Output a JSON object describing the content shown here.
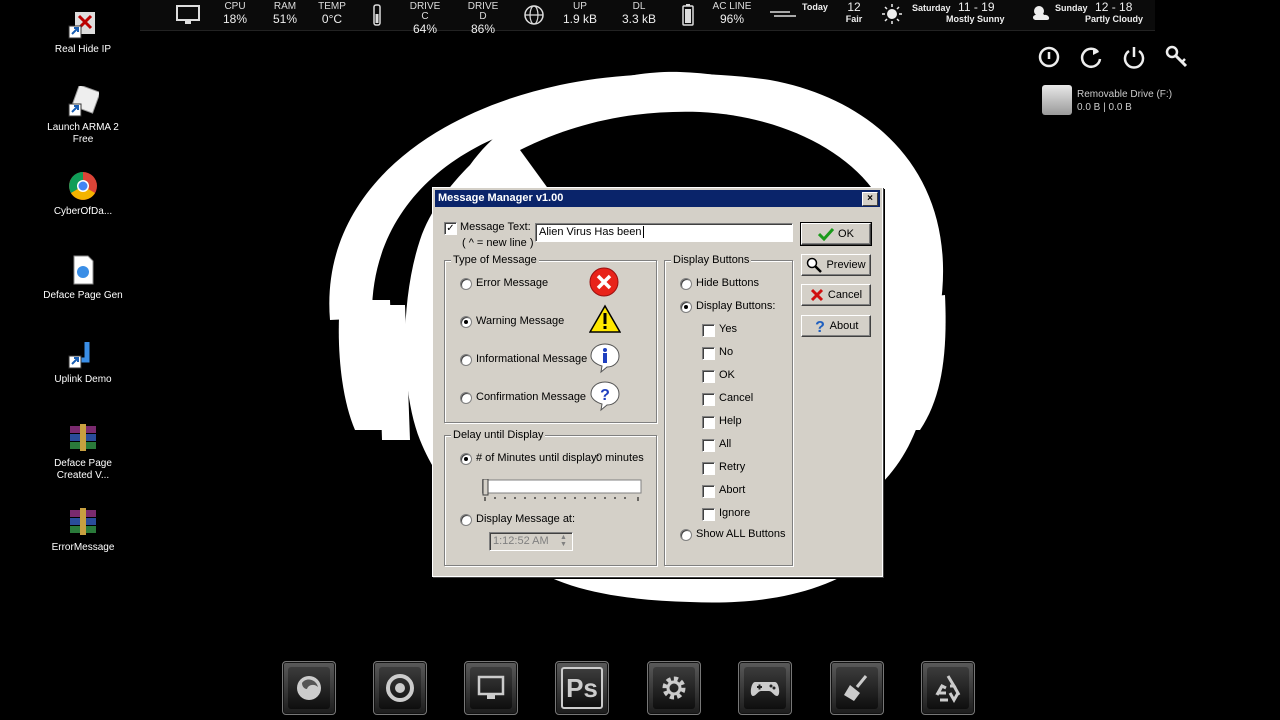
{
  "desktop": {
    "icons": [
      {
        "label": "Real Hide IP"
      },
      {
        "label": "Launch ARMA 2 Free"
      },
      {
        "label": "CyberOfDa..."
      },
      {
        "label": "Deface Page Gen"
      },
      {
        "label": "Uplink Demo"
      },
      {
        "label": "Deface Page Created V..."
      },
      {
        "label": "ErrorMessage"
      }
    ]
  },
  "statusbar": {
    "cpu": {
      "label": "CPU",
      "value": "18%"
    },
    "ram": {
      "label": "RAM",
      "value": "51%"
    },
    "temp": {
      "label": "TEMP",
      "value": "0°C"
    },
    "drive_c": {
      "label": "DRIVE C",
      "value": "64%"
    },
    "drive_d": {
      "label": "DRIVE D",
      "value": "86%"
    },
    "up": {
      "label": "UP",
      "value": "1.9 kB"
    },
    "dl": {
      "label": "DL",
      "value": "3.3 kB"
    },
    "ac": {
      "label": "AC LINE",
      "value": "96%"
    },
    "today": {
      "day": "Today",
      "temp": "12",
      "cond": "Fair"
    },
    "saturday": {
      "day": "Saturday",
      "range": "11 - 19",
      "cond": "Mostly Sunny"
    },
    "sunday": {
      "day": "Sunday",
      "range": "12 - 18",
      "cond": "Partly Cloudy"
    }
  },
  "drive_gadget": {
    "name": "Removable Drive (F:)",
    "usage": "0.0 B |   0.0 B"
  },
  "dialog": {
    "title": "Message Manager v1.00",
    "close": "×",
    "message_text_label": "Message Text:",
    "new_line_hint": "( ^ = new line )",
    "message_text_value": "Alien Virus Has been",
    "type_group": "Type of Message",
    "types": [
      "Error Message",
      "Warning Message",
      "Informational Message",
      "Confirmation Message"
    ],
    "selected_type": 1,
    "delay_group": "Delay until Display",
    "minutes_label": "# of Minutes until display:",
    "minutes_value": "0 minutes",
    "display_at_label": "Display Message at:",
    "time_value": "1:12:52 AM",
    "buttons_group": "Display Buttons",
    "hide_buttons": "Hide Buttons",
    "display_buttons": "Display Buttons:",
    "button_options": [
      "Yes",
      "No",
      "OK",
      "Cancel",
      "Help",
      "All",
      "Retry",
      "Abort",
      "Ignore"
    ],
    "show_all": "Show ALL Buttons",
    "actions": {
      "ok": "OK",
      "preview": "Preview",
      "cancel": "Cancel",
      "about": "About"
    },
    "colors": {
      "title_bar": "#0a246a",
      "face": "#d4d0c8"
    }
  }
}
